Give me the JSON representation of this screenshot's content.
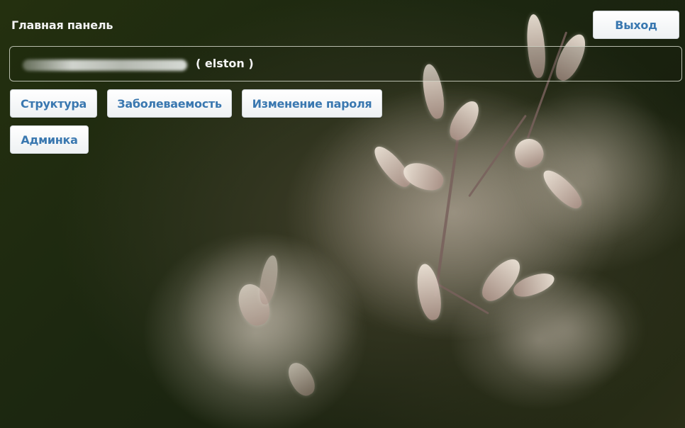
{
  "header": {
    "title": "Главная панель",
    "logout_label": "Выход"
  },
  "user": {
    "login_display": "( elston )"
  },
  "nav": {
    "structure_label": "Структура",
    "morbidity_label": "Заболеваемость",
    "change_password_label": "Изменение пароля",
    "admin_label": "Админка"
  },
  "colors": {
    "button_text": "#3a78b0",
    "header_text": "#f4f4f4",
    "background_dark": "#1c2710"
  }
}
